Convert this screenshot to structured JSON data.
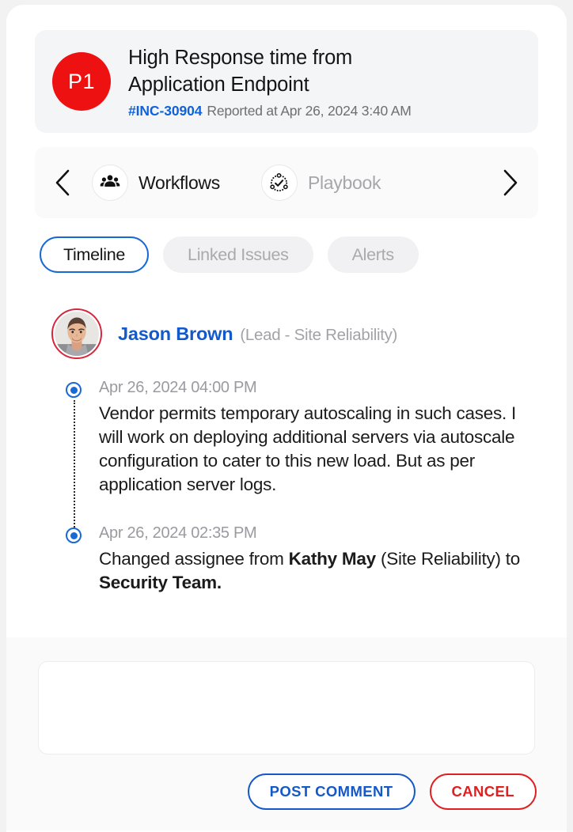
{
  "theme": {
    "accent_blue": "#1459c9",
    "link_blue": "#0f62d9",
    "priority_red": "#ee1111",
    "danger_red": "#e02020",
    "muted_gray": "#a2a2a7",
    "page_bg": "#f2f2f3"
  },
  "incident": {
    "priority": "P1",
    "title_line_1": "High Response time from",
    "title_line_2": "Application Endpoint",
    "id": "#INC-30904",
    "reported": "Reported at Apr 26, 2024 3:40 AM"
  },
  "nav": {
    "prev_icon": "chevron-left-icon",
    "next_icon": "chevron-right-icon",
    "items": [
      {
        "label": "Workflows",
        "icon": "people-group-icon",
        "active": true
      },
      {
        "label": "Playbook",
        "icon": "dotted-circle-check-icon",
        "active": false
      }
    ]
  },
  "tabs": [
    {
      "label": "Timeline",
      "active": true
    },
    {
      "label": "Linked Issues",
      "active": false
    },
    {
      "label": "Alerts",
      "active": false
    }
  ],
  "author": {
    "name": "Jason Brown",
    "role": "(Lead - Site Reliability)",
    "avatar": "user-photo-avatar"
  },
  "timeline": [
    {
      "time": "Apr 26, 2024 04:00 PM",
      "body_html": "Vendor permits temporary autoscaling in such cases. I will work on  deploying additional servers via autoscale configuration  to cater to this new load. But as per application server logs."
    },
    {
      "time": "Apr 26, 2024 02:35 PM",
      "body_html": "Changed assignee from <b>Kathy May</b> (Site Reliability) to  <b>Security Team.</b>"
    }
  ],
  "footer": {
    "comment_value": "",
    "comment_placeholder": "",
    "post_label": "POST COMMENT",
    "cancel_label": "CANCEL"
  }
}
